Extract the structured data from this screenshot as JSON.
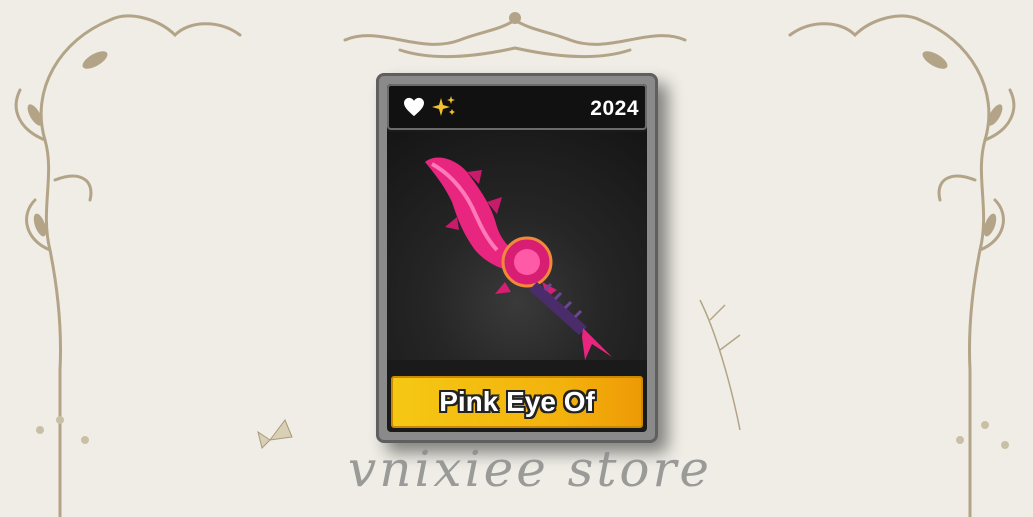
{
  "card": {
    "year": "2024",
    "item_name": "Pink Eye Of",
    "icons": [
      "heart-icon",
      "sparkle-icon"
    ]
  },
  "watermark": "vnixiee store",
  "colors": {
    "background": "#efede6",
    "ornament": "#b3a488",
    "card_frame": "#8a8a8a",
    "name_bar": "#f3b10c",
    "blade": "#e8257f"
  }
}
